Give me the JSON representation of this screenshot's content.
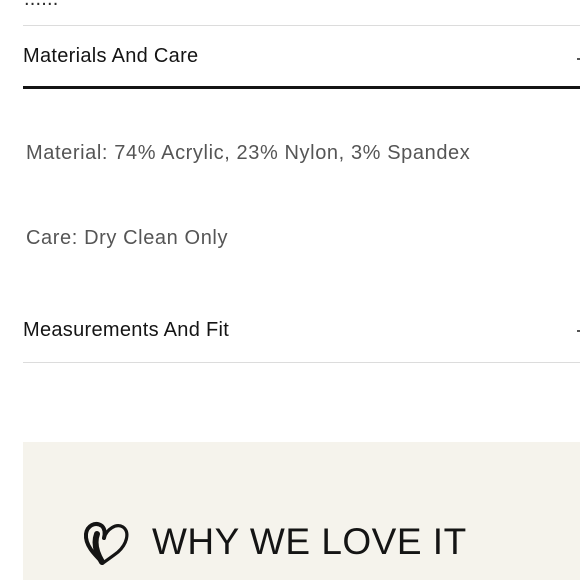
{
  "previous_section": {
    "label_fragment": "......"
  },
  "accordion": [
    {
      "title": "Materials And Care",
      "expanded": true,
      "details": [
        "Material: 74% Acrylic, 23% Nylon, 3% Spandex",
        "Care: Dry Clean Only"
      ]
    },
    {
      "title": "Measurements And Fit",
      "expanded": false
    }
  ],
  "why_section": {
    "icon": "heart-icon",
    "title": "WHY WE LOVE IT",
    "background_color": "#f5f3ec"
  }
}
